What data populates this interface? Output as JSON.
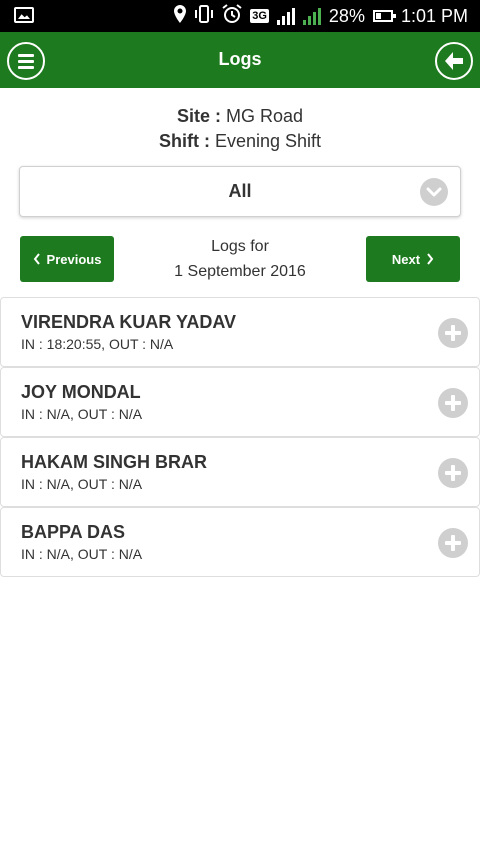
{
  "status_bar": {
    "battery": "28%",
    "time": "1:01 PM",
    "network": "3G",
    "icons": [
      "image-icon",
      "location-icon",
      "vibrate-icon",
      "alarm-icon",
      "network-3g-icon",
      "signal-sim1-icon",
      "signal-sim2-icon",
      "battery-icon"
    ]
  },
  "app_bar": {
    "title": "Logs",
    "menu_icon": "hamburger-menu-icon",
    "back_icon": "arrow-left-icon",
    "color": "#1e7a1e"
  },
  "site_info": {
    "site_label": "Site :",
    "site_value": "MG Road",
    "shift_label": "Shift :",
    "shift_value": "Evening Shift"
  },
  "filter": {
    "selected": "All",
    "icon": "chevron-down-icon"
  },
  "date_nav": {
    "prev_label": "Previous",
    "next_label": "Next",
    "logs_for_label": "Logs for",
    "date": "1 September 2016"
  },
  "logs": [
    {
      "name": "VIRENDRA KUAR YADAV",
      "times": "IN : 18:20:55, OUT : N/A"
    },
    {
      "name": "JOY MONDAL",
      "times": "IN : N/A, OUT : N/A"
    },
    {
      "name": "HAKAM SINGH BRAR",
      "times": "IN : N/A, OUT : N/A"
    },
    {
      "name": "BAPPA DAS",
      "times": "IN : N/A, OUT : N/A"
    }
  ]
}
